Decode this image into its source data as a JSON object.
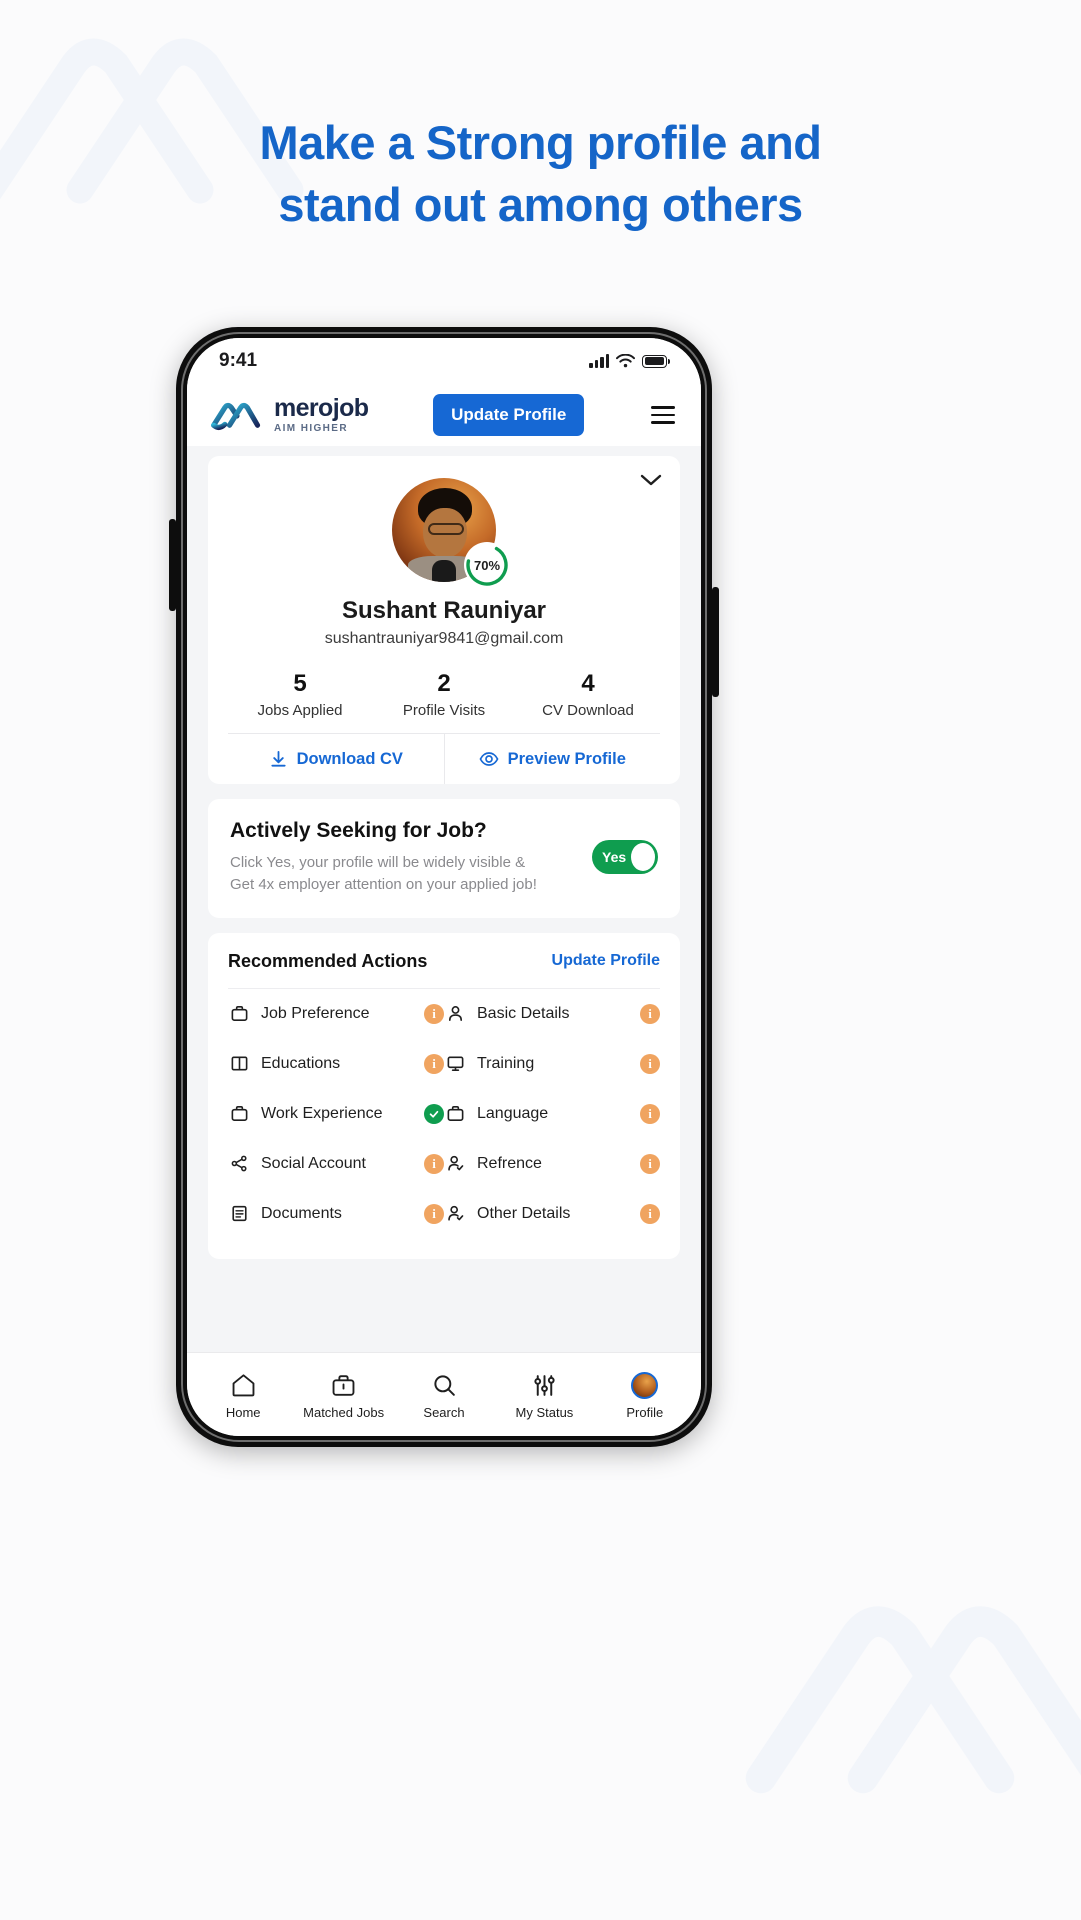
{
  "promo": {
    "line1": "Make a Strong profile and",
    "line2": "stand out among others",
    "color": "#1565c8"
  },
  "status_bar": {
    "time": "9:41",
    "signal_icon": "cellular-bars-icon",
    "wifi_icon": "wifi-icon",
    "battery_icon": "battery-full-icon"
  },
  "header": {
    "logo_name": "merojob",
    "logo_tagline": "AIM HIGHER",
    "update_button": "Update Profile",
    "menu_icon": "hamburger-menu-icon"
  },
  "profile": {
    "expand_icon": "chevron-down-icon",
    "completion": "70%",
    "completion_value": 70,
    "name": "Sushant Rauniyar",
    "email": "sushantrauniyar9841@gmail.com",
    "stats": [
      {
        "value": "5",
        "label": "Jobs Applied"
      },
      {
        "value": "2",
        "label": "Profile Visits"
      },
      {
        "value": "4",
        "label": "CV Download"
      }
    ],
    "actions": [
      {
        "label": "Download CV",
        "icon": "download-icon"
      },
      {
        "label": "Preview Profile",
        "icon": "eye-icon"
      }
    ]
  },
  "seeking": {
    "title": "Actively Seeking for Job?",
    "subtitle_line1": "Click Yes, your profile will be widely visible &",
    "subtitle_line2": "Get 4x employer attention on your applied job!",
    "toggle_label": "Yes",
    "toggle_on": true,
    "toggle_color": "#0f9d4f"
  },
  "recommended": {
    "title": "Recommended Actions",
    "link": "Update Profile",
    "items": [
      {
        "label": "Job Preference",
        "icon": "briefcase-icon",
        "status": "info"
      },
      {
        "label": "Basic Details",
        "icon": "person-icon",
        "status": "info"
      },
      {
        "label": "Educations",
        "icon": "book-open-icon",
        "status": "info"
      },
      {
        "label": "Training",
        "icon": "monitor-icon",
        "status": "info"
      },
      {
        "label": "Work Experience",
        "icon": "briefcase-icon",
        "status": "done"
      },
      {
        "label": "Language",
        "icon": "briefcase-icon",
        "status": "info"
      },
      {
        "label": "Social Account",
        "icon": "share-icon",
        "status": "info"
      },
      {
        "label": "Refrence",
        "icon": "person-check-icon",
        "status": "info"
      },
      {
        "label": "Documents",
        "icon": "document-icon",
        "status": "info"
      },
      {
        "label": "Other Details",
        "icon": "person-check-icon",
        "status": "info"
      }
    ],
    "badge_info_color": "#f0a460",
    "badge_done_color": "#0f9d4f"
  },
  "bottom_nav": [
    {
      "label": "Home",
      "icon": "home-icon",
      "active": false
    },
    {
      "label": "Matched Jobs",
      "icon": "briefcase-icon",
      "active": false
    },
    {
      "label": "Search",
      "icon": "search-icon",
      "active": false
    },
    {
      "label": "My Status",
      "icon": "sliders-icon",
      "active": false
    },
    {
      "label": "Profile",
      "icon": "avatar-icon",
      "active": true
    }
  ]
}
